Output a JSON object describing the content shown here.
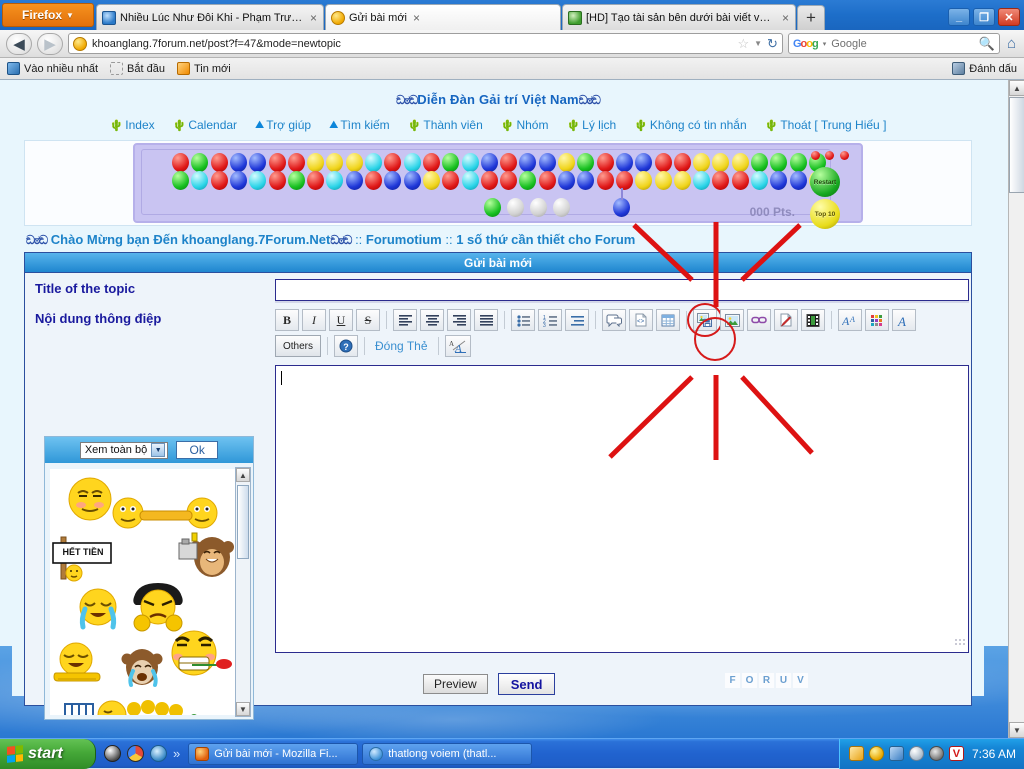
{
  "browser": {
    "app_button": "Firefox",
    "tabs": [
      {
        "label": "Nhiều Lúc Như Đôi Khi - Phạm Trưởng (VB...",
        "favicon": "music-note-icon",
        "active": false,
        "close": "×"
      },
      {
        "label": "Gửi bài mới",
        "favicon": "smiley-icon",
        "active": true,
        "close": "×"
      },
      {
        "label": "[HD] Tạo tài sản bên dưới bài viết với Ch...",
        "favicon": "globe-icon",
        "active": false,
        "close": "×"
      }
    ],
    "new_tab_label": "+",
    "window_controls": {
      "minimize": "_",
      "maximize": "❐",
      "close": "✕"
    },
    "nav": {
      "back": "◀",
      "forward": "▶",
      "reload": "↻",
      "star": "☆",
      "dropdown": "▼",
      "home": "⌂"
    },
    "url": "khoanglang.7forum.net/post?f=47&mode=newtopic",
    "url_favicon": "smiley-icon",
    "search": {
      "engine": "Google",
      "placeholder": "Google",
      "value": "",
      "icon": "magnifier-icon",
      "dropdown": "▾"
    },
    "bookmarks": [
      {
        "label": "Vào nhiều nhất",
        "icon": "most-visited-icon"
      },
      {
        "label": "Bắt đầu",
        "icon": "getting-started-icon"
      },
      {
        "label": "Tin mới",
        "icon": "rss-feed-icon"
      }
    ],
    "bookmarks_right": {
      "label": "Đánh dấu",
      "icon": "bookmarks-star-icon"
    }
  },
  "forum": {
    "site_title": "Diễn Đàn Gải trí Việt Nam",
    "title_deco_left": "ඞಠඞ",
    "title_deco_right": "ඞಠඞ",
    "nav_links": [
      {
        "label": "Index",
        "icon": "home-bookmark-icon"
      },
      {
        "label": "Calendar",
        "icon": "calendar-icon"
      },
      {
        "label": "Trợ giúp",
        "icon": "help-icon"
      },
      {
        "label": "Tìm kiếm",
        "icon": "search-icon"
      },
      {
        "label": "Thành viên",
        "icon": "members-icon"
      },
      {
        "label": "Nhóm",
        "icon": "groups-icon"
      },
      {
        "label": "Lý lịch",
        "icon": "profile-icon"
      },
      {
        "label": "Không có tin nhắn",
        "icon": "messages-icon"
      },
      {
        "label": "Thoát [ Trung Hiếu ]",
        "icon": "logout-icon"
      }
    ],
    "welcome": {
      "greeting": "Chào Mừng bạn Đến khoanglang.7Forum.Net",
      "separator": " :: ",
      "crumb1": "Forumotium",
      "crumb2": "1 số thứ cần thiết cho Forum"
    }
  },
  "game": {
    "name": "bubble-shooter-banner",
    "score_label": "000 Pts.",
    "restart_label": "Restart",
    "top10_label": "Top 10",
    "lives": 3,
    "rows": [
      [
        "red",
        "green",
        "red",
        "blue",
        "blue",
        "red",
        "red",
        "yellow",
        "yellow",
        "yellow",
        "cyan",
        "red",
        "cyan",
        "red",
        "green",
        "cyan",
        "blue",
        "red",
        "blue",
        "blue",
        "yellow",
        "green",
        "red",
        "blue",
        "blue",
        "red",
        "red",
        "yellow",
        "yellow",
        "yellow",
        "green",
        "green",
        "green",
        "green"
      ],
      [
        "green",
        "cyan",
        "red",
        "blue",
        "cyan",
        "red",
        "green",
        "red",
        "cyan",
        "blue",
        "red",
        "blue",
        "blue",
        "yellow",
        "red",
        "cyan",
        "red",
        "red",
        "green",
        "red",
        "blue",
        "blue",
        "red",
        "red",
        "yellow",
        "yellow",
        "yellow",
        "cyan",
        "red",
        "red",
        "cyan",
        "blue",
        "blue",
        "yellow"
      ]
    ],
    "queue": [
      "green",
      "grey",
      "grey",
      "grey"
    ],
    "shooter_ball": "blue"
  },
  "post_form": {
    "header": "Gửi bài mới",
    "title_label": "Title of the topic",
    "title_value": "",
    "title_placeholder": "",
    "message_label": "Nội dung thông điệp",
    "message_value": "",
    "toolbar_row1": [
      {
        "name": "bold-button",
        "label": "B",
        "icon": "bold-icon"
      },
      {
        "name": "italic-button",
        "label": "I",
        "icon": "italic-icon"
      },
      {
        "name": "underline-button",
        "label": "U",
        "icon": "underline-icon"
      },
      {
        "name": "strikethrough-button",
        "label": "S",
        "icon": "strikethrough-icon"
      },
      {
        "name": "align-left-button",
        "label": "",
        "icon": "align-left-icon"
      },
      {
        "name": "align-center-button",
        "label": "",
        "icon": "align-center-icon"
      },
      {
        "name": "align-right-button",
        "label": "",
        "icon": "align-right-icon"
      },
      {
        "name": "align-justify-button",
        "label": "",
        "icon": "align-justify-icon"
      },
      {
        "name": "bullet-list-button",
        "label": "",
        "icon": "bullet-list-icon"
      },
      {
        "name": "numbered-list-button",
        "label": "",
        "icon": "numbered-list-icon"
      },
      {
        "name": "indent-button",
        "label": "",
        "icon": "indent-icon"
      },
      {
        "name": "quote-button",
        "label": "",
        "icon": "quote-bubble-icon"
      },
      {
        "name": "code-button",
        "label": "",
        "icon": "code-icon"
      },
      {
        "name": "table-button",
        "label": "",
        "icon": "table-icon"
      },
      {
        "name": "host-image-button",
        "label": "",
        "icon": "image-save-icon",
        "highlighted": true
      },
      {
        "name": "insert-image-button",
        "label": "",
        "icon": "image-icon"
      },
      {
        "name": "insert-link-button",
        "label": "",
        "icon": "link-chain-icon"
      },
      {
        "name": "flash-button",
        "label": "",
        "icon": "flash-pen-icon"
      },
      {
        "name": "video-button",
        "label": "",
        "icon": "film-strip-icon"
      },
      {
        "name": "font-size-button",
        "label": "",
        "icon": "font-size-icon"
      },
      {
        "name": "font-color-button",
        "label": "",
        "icon": "color-palette-icon"
      },
      {
        "name": "font-face-button",
        "label": "",
        "icon": "font-face-icon"
      }
    ],
    "toolbar_row2": {
      "others_label": "Others",
      "help_icon": "help-question-icon",
      "close_tags_label": "Đóng Thẻ",
      "remove_format_icon": "remove-format-icon"
    },
    "preview_label": "Preview",
    "send_label": "Send",
    "forum_logo_letters": [
      "F",
      "O",
      "R",
      "U",
      "V"
    ]
  },
  "smilies": {
    "select_value": "Xem toàn bộ",
    "ok_label": "Ok",
    "sign_text": "HẾT TIỀN",
    "items": [
      "smirk-blush-smiley",
      "handshake-smiley",
      "smug-smiley",
      "sign-het-tien-smiley",
      "blank-smiley",
      "monkey-camera-smiley",
      "crying-laughing-smiley",
      "angry-fists-smiley",
      "laughing-hands-smiley",
      "crying-monkey-smiley",
      "rose-in-teeth-smiley",
      "piano-smiley"
    ]
  },
  "annotation": {
    "type": "red-starburst-highlight",
    "target": "host-image-button",
    "circle_color": "#d61a1a",
    "ray_color": "#dd1212",
    "ray_count": 6
  },
  "taskbar": {
    "start_label": "start",
    "quick_launch": [
      {
        "name": "opera-icon"
      },
      {
        "name": "chrome-icon"
      },
      {
        "name": "internet-explorer-icon"
      },
      {
        "name": "show-more-icon",
        "label": "»"
      }
    ],
    "windows": [
      {
        "label": "Gửi bài mới - Mozilla Fi...",
        "icon": "firefox-icon",
        "active": true
      },
      {
        "label": "thatlong voiem (thatl...",
        "icon": "yahoo-messenger-icon",
        "active": false
      }
    ],
    "tray": [
      {
        "name": "mail-icon"
      },
      {
        "name": "yahoo-smiley-icon"
      },
      {
        "name": "network-icon"
      },
      {
        "name": "unikey-bot-icon"
      },
      {
        "name": "volume-icon"
      },
      {
        "name": "vietkey-icon",
        "label": "V"
      }
    ],
    "clock": "7:36 AM"
  }
}
